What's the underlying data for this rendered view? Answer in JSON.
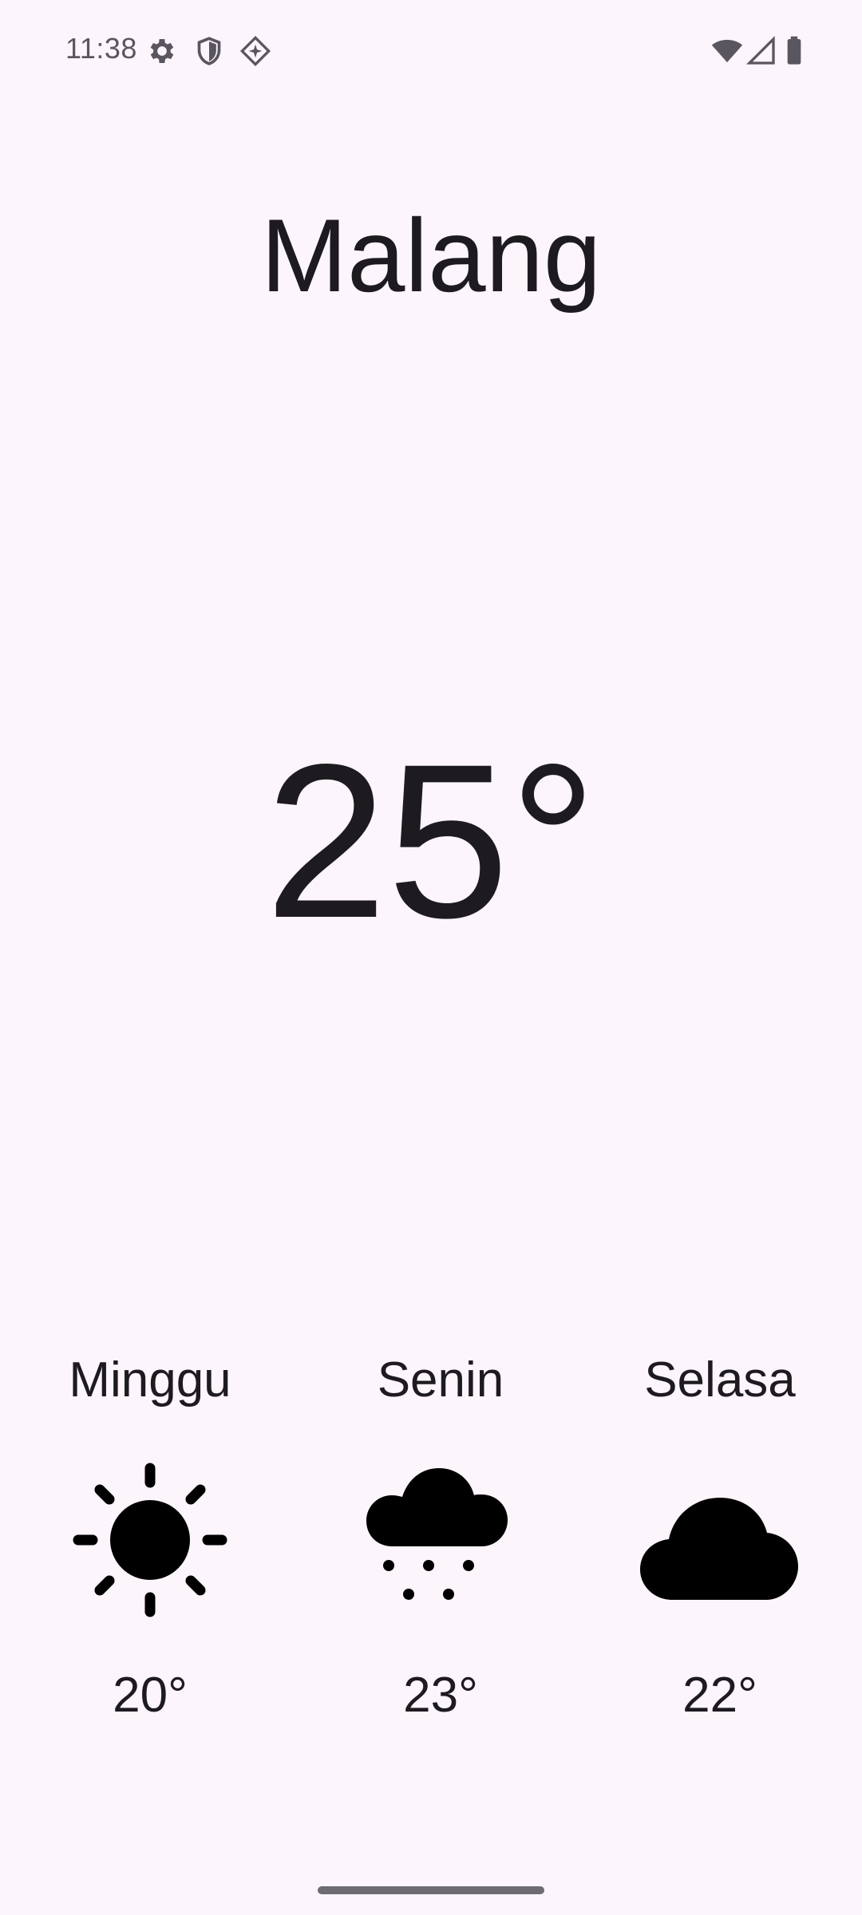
{
  "status_bar": {
    "time": "11:38",
    "icons": [
      "gear-icon",
      "shield-icon",
      "location-diamond-icon",
      "wifi-icon",
      "cellular-signal-icon",
      "battery-icon"
    ]
  },
  "weather": {
    "city": "Malang",
    "current_temp": "25°",
    "forecast": [
      {
        "day": "Minggu",
        "icon": "sun-icon",
        "temp": "20°"
      },
      {
        "day": "Senin",
        "icon": "snow-cloud-icon",
        "temp": "23°"
      },
      {
        "day": "Selasa",
        "icon": "cloud-icon",
        "temp": "22°"
      }
    ]
  },
  "colors": {
    "background": "#FCF5FC",
    "text": "#1D1B20",
    "status_text": "#5A5660"
  }
}
